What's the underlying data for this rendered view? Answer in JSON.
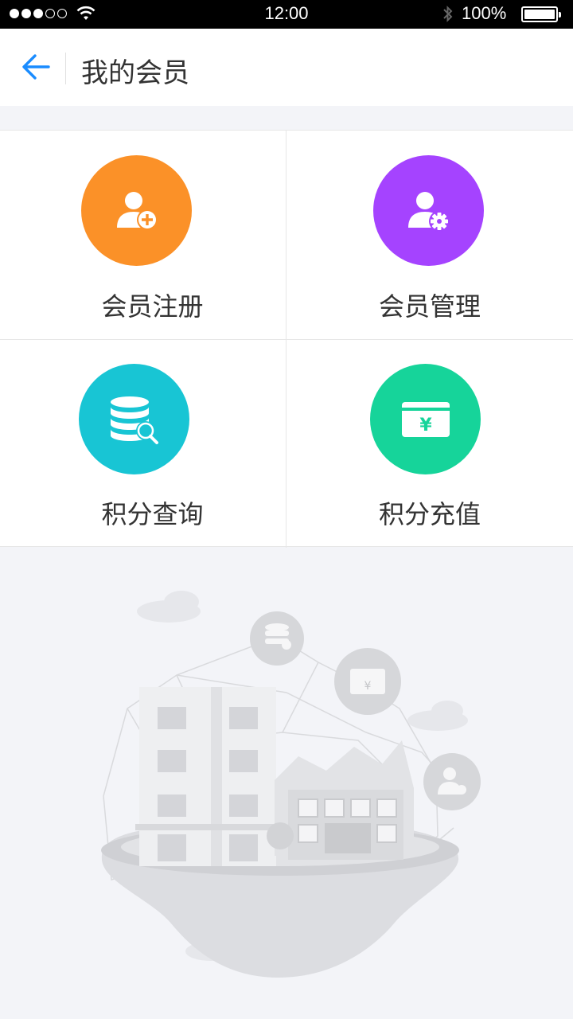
{
  "status_bar": {
    "time": "12:00",
    "battery": "100%"
  },
  "nav": {
    "title": "我的会员",
    "back_icon": "arrow-left-icon"
  },
  "menu": {
    "items": [
      {
        "label": "会员注册",
        "icon": "user-add-icon",
        "color": "#fb9128"
      },
      {
        "label": "会员管理",
        "icon": "user-settings-icon",
        "color": "#a543ff"
      },
      {
        "label": "积分查询",
        "icon": "database-search-icon",
        "color": "#18c5d4"
      },
      {
        "label": "积分充值",
        "icon": "card-yuan-icon",
        "color": "#16d49a"
      }
    ]
  },
  "illustration": {
    "icon": "floating-island-buildings-illustration",
    "card_symbol": "¥"
  },
  "colors": {
    "accent": "#1a8cff",
    "background": "#f3f4f8"
  }
}
